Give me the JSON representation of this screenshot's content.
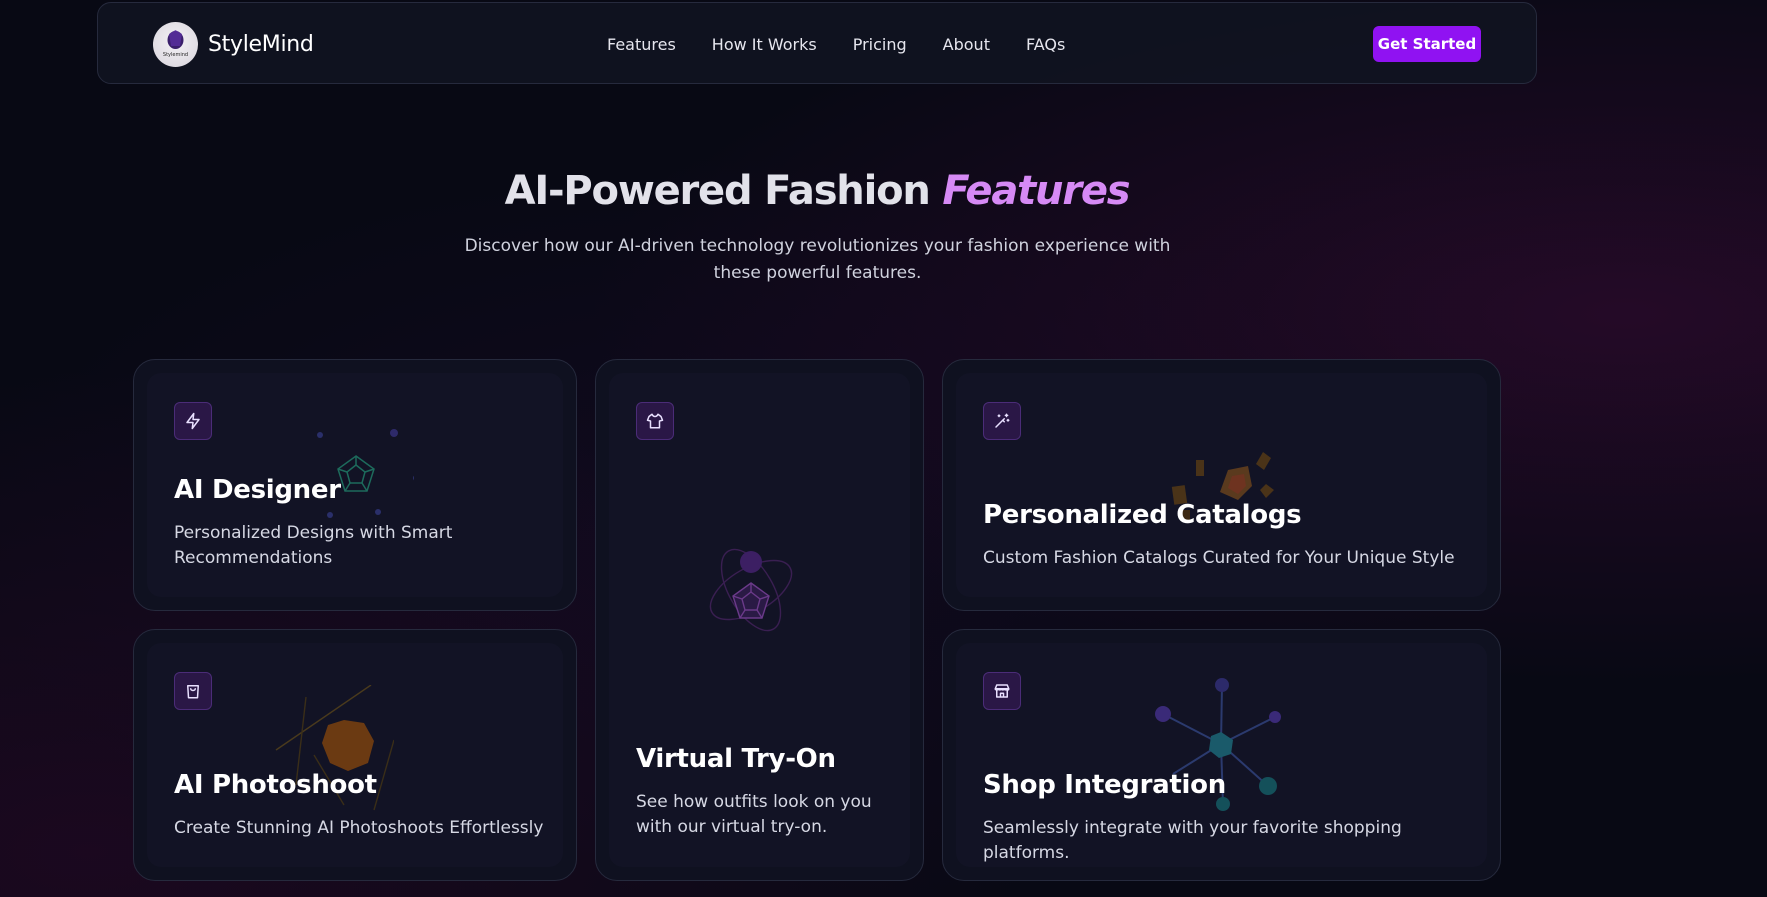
{
  "nav": {
    "brand": "StyleMind",
    "logo_text": "Stylemind",
    "links": [
      "Features",
      "How It Works",
      "Pricing",
      "About",
      "FAQs"
    ],
    "cta": "Get Started"
  },
  "hero": {
    "title_main": "AI-Powered Fashion",
    "title_accent": "Features",
    "subtitle": "Discover how our AI-driven technology revolutionizes your fashion experience with these powerful features."
  },
  "features": [
    {
      "icon": "lightning-icon",
      "title": "AI Designer",
      "desc": "Personalized Designs with Smart Recommendations"
    },
    {
      "icon": "shirt-icon",
      "title": "Virtual Try-On",
      "desc": "See how outfits look on you with our virtual try-on."
    },
    {
      "icon": "magic-wand-icon",
      "title": "Personalized Catalogs",
      "desc": "Custom Fashion Catalogs Curated for Your Unique Style"
    },
    {
      "icon": "shopping-bag-icon",
      "title": "AI Photoshoot",
      "desc": "Create Stunning AI Photoshoots Effortlessly"
    },
    {
      "icon": "store-icon",
      "title": "Shop Integration",
      "desc": "Seamlessly integrate with your favorite shopping platforms."
    }
  ],
  "colors": {
    "background": "#080914",
    "accent": "#9012f2",
    "accent_text": "#d68af5",
    "card": "#0f1120"
  }
}
